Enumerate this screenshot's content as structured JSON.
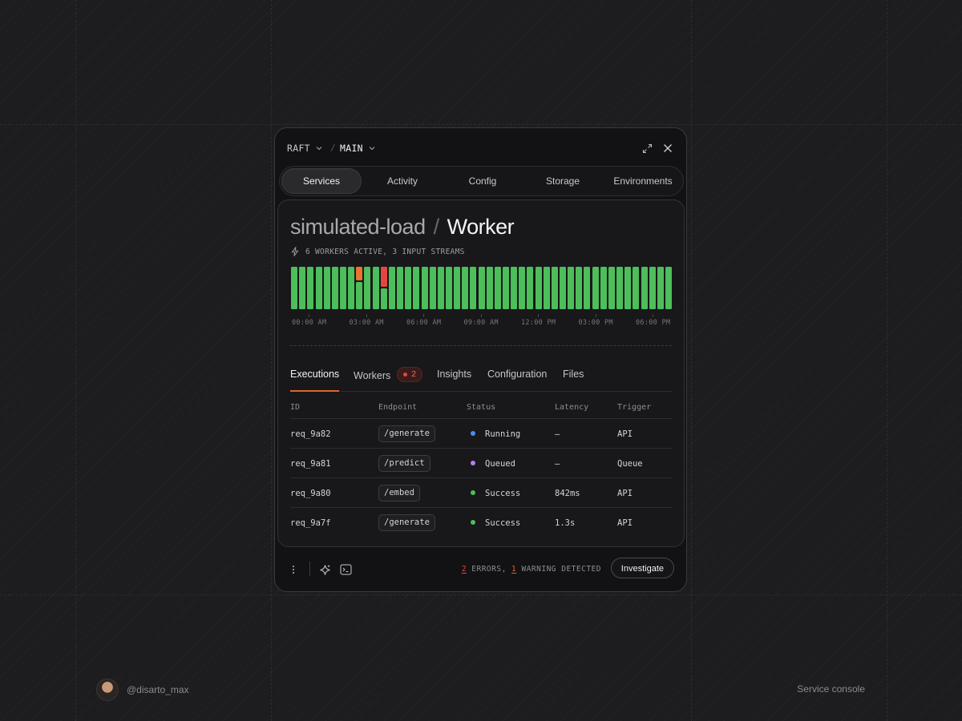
{
  "window": {
    "breadcrumb": [
      {
        "label": "RAFT"
      },
      {
        "label": "MAIN"
      }
    ],
    "breadcrumb_separator": "/"
  },
  "tabs": [
    "Services",
    "Activity",
    "Config",
    "Storage",
    "Environments"
  ],
  "active_tab": "Services",
  "service": {
    "name": "simulated-load",
    "separator": "/",
    "type": "Worker",
    "subtitle": "6 WORKERS ACTIVE, 3 INPUT STREAMS"
  },
  "chart_data": {
    "type": "bar",
    "description_of_states": "status history per time slot",
    "slot_count": 47,
    "states": [
      "ok",
      "ok",
      "ok",
      "ok",
      "ok",
      "ok",
      "ok",
      "ok",
      "warning",
      "ok",
      "ok",
      "error",
      "ok",
      "ok",
      "ok",
      "ok",
      "ok",
      "ok",
      "ok",
      "ok",
      "ok",
      "ok",
      "ok",
      "ok",
      "ok",
      "ok",
      "ok",
      "ok",
      "ok",
      "ok",
      "ok",
      "ok",
      "ok",
      "ok",
      "ok",
      "ok",
      "ok",
      "ok",
      "ok",
      "ok",
      "ok",
      "ok",
      "ok",
      "ok",
      "ok",
      "ok",
      "ok"
    ],
    "x_tick_labels": [
      "00:00 AM",
      "03:00 AM",
      "06:00 AM",
      "09:00 AM",
      "12:00 PM",
      "03:00 PM",
      "06:00 PM"
    ],
    "colors": {
      "ok": "#4cbe5a",
      "warning": "#e8742e",
      "error": "#e5473f"
    }
  },
  "subtabs": [
    {
      "label": "Executions"
    },
    {
      "label": "Workers",
      "badge": "2"
    },
    {
      "label": "Insights"
    },
    {
      "label": "Configuration"
    },
    {
      "label": "Files"
    }
  ],
  "active_subtab": "Executions",
  "table": {
    "columns": [
      "ID",
      "Endpoint",
      "Status",
      "Latency",
      "Trigger"
    ],
    "rows": [
      {
        "id": "req_9a82",
        "endpoint": "/generate",
        "status": "Running",
        "status_color": "#4b8df0",
        "latency": "—",
        "trigger": "API"
      },
      {
        "id": "req_9a81",
        "endpoint": "/predict",
        "status": "Queued",
        "status_color": "#b47ff0",
        "latency": "—",
        "trigger": "Queue"
      },
      {
        "id": "req_9a80",
        "endpoint": "/embed",
        "status": "Success",
        "status_color": "#4cbe5a",
        "latency": "842ms",
        "trigger": "API"
      },
      {
        "id": "req_9a7f",
        "endpoint": "/generate",
        "status": "Success",
        "status_color": "#4cbe5a",
        "latency": "1.3s",
        "trigger": "API"
      }
    ]
  },
  "footer": {
    "errors_count": "2",
    "errors_text": " ERRORS, ",
    "warning_count": "1",
    "warning_text": " WARNING DETECTED",
    "investigate_label": "Investigate"
  },
  "page": {
    "author_handle": "@disarto_max",
    "label": "Service console"
  },
  "icons": {
    "crumb_chevron": "chevron-down-icon",
    "expand": "expand-icon",
    "close": "close-icon",
    "subtitle": "lightning-icon",
    "more": "more-vertical-icon",
    "ai": "sparkle-icon",
    "terminal": "terminal-icon"
  }
}
